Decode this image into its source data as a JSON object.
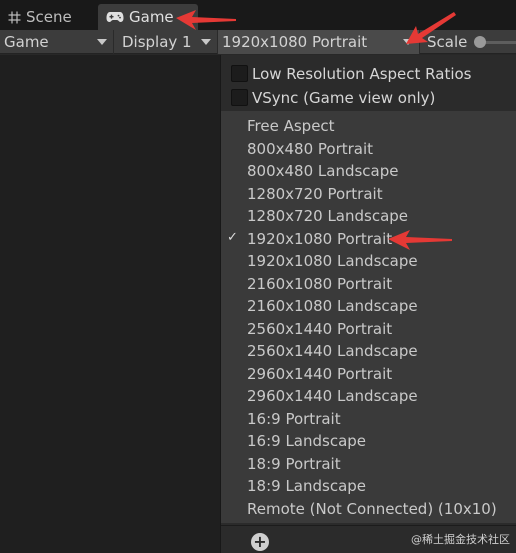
{
  "tabs": {
    "scene_label": "Scene",
    "game_label": "Game"
  },
  "toolbar": {
    "view_mode_label": "Game",
    "display_label": "Display 1",
    "resolution_label": "1920x1080 Portrait",
    "scale_label": "Scale"
  },
  "popup": {
    "low_res_label": "Low Resolution Aspect Ratios",
    "vsync_label": "VSync (Game view only)",
    "items": [
      {
        "label": "Free Aspect"
      },
      {
        "label": "800x480 Portrait"
      },
      {
        "label": "800x480 Landscape"
      },
      {
        "label": "1280x720 Portrait"
      },
      {
        "label": "1280x720 Landscape"
      },
      {
        "label": "1920x1080 Portrait"
      },
      {
        "label": "1920x1080 Landscape"
      },
      {
        "label": "2160x1080 Portrait"
      },
      {
        "label": "2160x1080 Landscape"
      },
      {
        "label": "2560x1440 Portrait"
      },
      {
        "label": "2560x1440 Landscape"
      },
      {
        "label": "2960x1440 Portrait"
      },
      {
        "label": "2960x1440 Landscape"
      },
      {
        "label": "16:9 Portrait"
      },
      {
        "label": "16:9 Landscape"
      },
      {
        "label": "18:9 Portrait"
      },
      {
        "label": "18:9 Landscape"
      },
      {
        "label": "Remote (Not Connected) (10x10)"
      }
    ],
    "checkmark": "✓",
    "add_button_glyph": "+"
  },
  "watermark": "@稀土掘金技术社区",
  "colors": {
    "annotation_red": "#e53935",
    "panel_bg": "#2b2b2b",
    "list_bg": "#3a3a3a"
  },
  "icons": {
    "scene_tab": "grid-icon",
    "game_tab": "gamepad-icon",
    "add": "plus-circle-icon",
    "selected": "checkmark-icon"
  }
}
